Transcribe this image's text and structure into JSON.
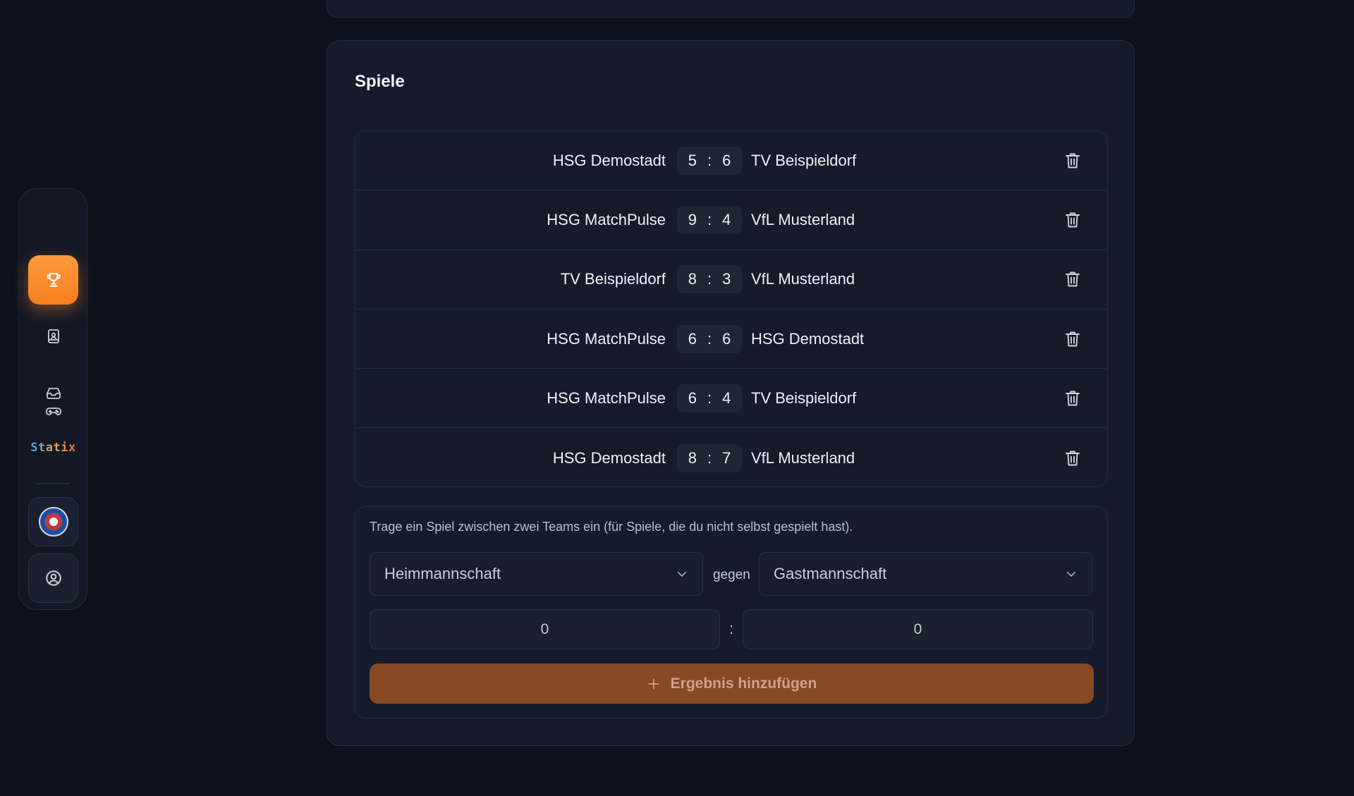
{
  "nav": {
    "items": [
      {
        "icon": "gamepad-icon",
        "active": false
      },
      {
        "icon": "trophy-icon",
        "active": true
      },
      {
        "icon": "contact-book-icon",
        "active": false
      },
      {
        "icon": "inbox-icon",
        "active": false
      }
    ],
    "logo_text": "Statix",
    "accent_color": "#f7891f"
  },
  "section": {
    "title": "Spiele"
  },
  "games": [
    {
      "home": "HSG Demostadt",
      "home_score": "5",
      "separator": ":",
      "away_score": "6",
      "away": "TV Beispieldorf"
    },
    {
      "home": "HSG MatchPulse",
      "home_score": "9",
      "separator": ":",
      "away_score": "4",
      "away": "VfL Musterland"
    },
    {
      "home": "TV Beispieldorf",
      "home_score": "8",
      "separator": ":",
      "away_score": "3",
      "away": "VfL Musterland"
    },
    {
      "home": "HSG MatchPulse",
      "home_score": "6",
      "separator": ":",
      "away_score": "6",
      "away": "HSG Demostadt"
    },
    {
      "home": "HSG MatchPulse",
      "home_score": "6",
      "separator": ":",
      "away_score": "4",
      "away": "TV Beispieldorf"
    },
    {
      "home": "HSG Demostadt",
      "home_score": "8",
      "separator": ":",
      "away_score": "7",
      "away": "VfL Musterland"
    }
  ],
  "form": {
    "hint": "Trage ein Spiel zwischen zwei Teams ein (für Spiele, die du nicht selbst gespielt hast).",
    "home_select": "Heimmannschaft",
    "vs_label": "gegen",
    "away_select": "Gastmannschaft",
    "home_goals": "0",
    "score_separator": ":",
    "away_goals": "0",
    "submit_label": "Ergebnis hinzufügen"
  }
}
